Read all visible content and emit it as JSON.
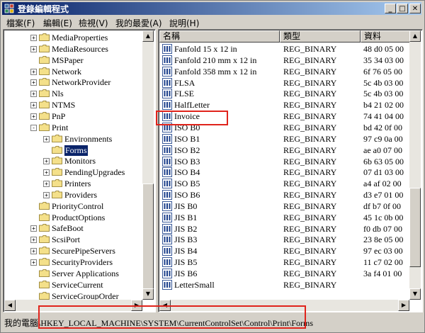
{
  "window": {
    "title": "登錄編輯程式",
    "controls": {
      "minimize": "_",
      "maximize": "□",
      "close": "✕"
    }
  },
  "menu": [
    {
      "label": "檔案(F)"
    },
    {
      "label": "編輯(E)"
    },
    {
      "label": "檢視(V)"
    },
    {
      "label": "我的最愛(A)"
    },
    {
      "label": "說明(H)"
    }
  ],
  "tree": {
    "items": [
      {
        "label": "MediaProperties",
        "expander": "+"
      },
      {
        "label": "MediaResources",
        "expander": "+"
      },
      {
        "label": "MSPaper",
        "expander": ""
      },
      {
        "label": "Network",
        "expander": "+"
      },
      {
        "label": "NetworkProvider",
        "expander": "+"
      },
      {
        "label": "Nls",
        "expander": "+"
      },
      {
        "label": "NTMS",
        "expander": "+"
      },
      {
        "label": "PnP",
        "expander": "+"
      },
      {
        "label": "Print",
        "expander": "-"
      },
      {
        "label": "Environments",
        "expander": "+"
      },
      {
        "label": "Forms",
        "expander": ""
      },
      {
        "label": "Monitors",
        "expander": "+"
      },
      {
        "label": "PendingUpgrades",
        "expander": "+"
      },
      {
        "label": "Printers",
        "expander": "+"
      },
      {
        "label": "Providers",
        "expander": "+"
      },
      {
        "label": "PriorityControl",
        "expander": ""
      },
      {
        "label": "ProductOptions",
        "expander": ""
      },
      {
        "label": "SafeBoot",
        "expander": "+"
      },
      {
        "label": "ScsiPort",
        "expander": "+"
      },
      {
        "label": "SecurePipeServers",
        "expander": "+"
      },
      {
        "label": "SecurityProviders",
        "expander": "+"
      },
      {
        "label": "Server Applications",
        "expander": ""
      },
      {
        "label": "ServiceCurrent",
        "expander": ""
      },
      {
        "label": "ServiceGroupOrder",
        "expander": ""
      }
    ],
    "selected": "Forms"
  },
  "list": {
    "columns": {
      "name": "名稱",
      "type": "類型",
      "data": "資料"
    },
    "rows": [
      {
        "name": "Fanfold 15 x 12 in",
        "type": "REG_BINARY",
        "data": "48 d0 05 00"
      },
      {
        "name": "Fanfold 210 mm x 12 in",
        "type": "REG_BINARY",
        "data": "35 34 03 00"
      },
      {
        "name": "Fanfold 358 mm x 12 in",
        "type": "REG_BINARY",
        "data": "6f 76 05 00"
      },
      {
        "name": "FLSA",
        "type": "REG_BINARY",
        "data": "5c 4b 03 00"
      },
      {
        "name": "FLSE",
        "type": "REG_BINARY",
        "data": "5c 4b 03 00"
      },
      {
        "name": "HalfLetter",
        "type": "REG_BINARY",
        "data": "b4 21 02 00"
      },
      {
        "name": "Invoice",
        "type": "REG_BINARY",
        "data": "74 41 04 00"
      },
      {
        "name": "ISO B0",
        "type": "REG_BINARY",
        "data": "bd 42 0f 00"
      },
      {
        "name": "ISO B1",
        "type": "REG_BINARY",
        "data": "97 c9 0a 00"
      },
      {
        "name": "ISO B2",
        "type": "REG_BINARY",
        "data": "ae a0 07 00"
      },
      {
        "name": "ISO B3",
        "type": "REG_BINARY",
        "data": "6b 63 05 00"
      },
      {
        "name": "ISO B4",
        "type": "REG_BINARY",
        "data": "07 d1 03 00"
      },
      {
        "name": "ISO B5",
        "type": "REG_BINARY",
        "data": "a4 af 02 00"
      },
      {
        "name": "ISO B6",
        "type": "REG_BINARY",
        "data": "d3 e7 01 00"
      },
      {
        "name": "JIS B0",
        "type": "REG_BINARY",
        "data": "df b7 0f 00"
      },
      {
        "name": "JIS B1",
        "type": "REG_BINARY",
        "data": "45 1c 0b 00"
      },
      {
        "name": "JIS B2",
        "type": "REG_BINARY",
        "data": "f0 db 07 00"
      },
      {
        "name": "JIS B3",
        "type": "REG_BINARY",
        "data": "23 8e 05 00"
      },
      {
        "name": "JIS B4",
        "type": "REG_BINARY",
        "data": "97 ec 03 00"
      },
      {
        "name": "JIS B5",
        "type": "REG_BINARY",
        "data": "11 c7 02 00"
      },
      {
        "name": "JIS B6",
        "type": "REG_BINARY",
        "data": "3a f4 01 00"
      },
      {
        "name": "LetterSmall",
        "type": "REG_BINARY",
        "data": ""
      }
    ]
  },
  "status": {
    "computer": "我的電腦",
    "path": "\\HKEY_LOCAL_MACHINE\\SYSTEM\\CurrentControlSet\\Control\\Print\\Forms"
  },
  "colors": {
    "title_start": "#0a246a",
    "title_end": "#a6caf0",
    "selection": "#0a246a",
    "highlight_box": "#e0241c",
    "face": "#d4d0c8"
  }
}
